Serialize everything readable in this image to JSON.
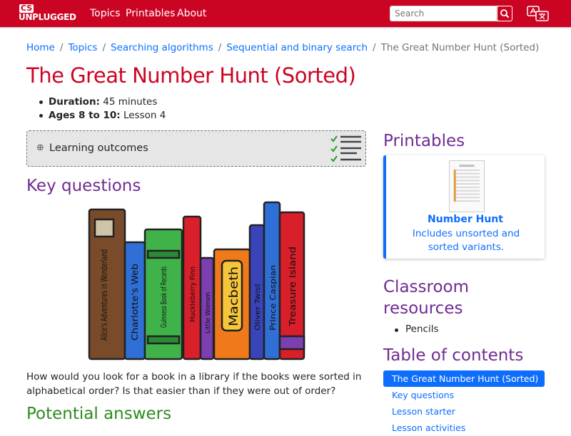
{
  "nav": {
    "logo_top": "CS",
    "logo_bottom": "UNPLUGGED",
    "links": [
      "Topics",
      "Printables",
      "About"
    ],
    "search_placeholder": "Search"
  },
  "breadcrumb": [
    "Home",
    "Topics",
    "Searching algorithms",
    "Sequential and binary search"
  ],
  "breadcrumb_current": "The Great Number Hunt (Sorted)",
  "title": "The Great Number Hunt (Sorted)",
  "meta": {
    "duration_label": "Duration:",
    "duration_value": "45 minutes",
    "ages_label": "Ages 8 to 10:",
    "ages_value": "Lesson 4"
  },
  "learning_outcomes": "Learning outcomes",
  "key_questions": "Key questions",
  "books": [
    "Alice's Adventures in Wonderland",
    "Charlotte's Web",
    "Guinness Book of Records",
    "Huckleberry Finn",
    "Little Women",
    "Macbeth",
    "Oliver Twist",
    "Prince Caspian",
    "Treasure Island"
  ],
  "question_text": "How would you look for a book in a library if the books were sorted in alphabetical order? Is that easier than if they were out of order?",
  "potential_answers": "Potential answers",
  "sidebar": {
    "printables_heading": "Printables",
    "printable_title": "Number Hunt",
    "printable_desc": "Includes unsorted and sorted variants.",
    "classroom_heading": "Classroom resources",
    "resources": [
      "Pencils"
    ],
    "toc_heading": "Table of contents",
    "toc": [
      "The Great Number Hunt (Sorted)",
      "Key questions",
      "Lesson starter",
      "Lesson activities"
    ]
  },
  "colors": {
    "brand_red": "#cc0423",
    "heading_purple": "#6f2c91",
    "link_blue": "#0d6efd",
    "answer_green": "#2e8b1e"
  }
}
